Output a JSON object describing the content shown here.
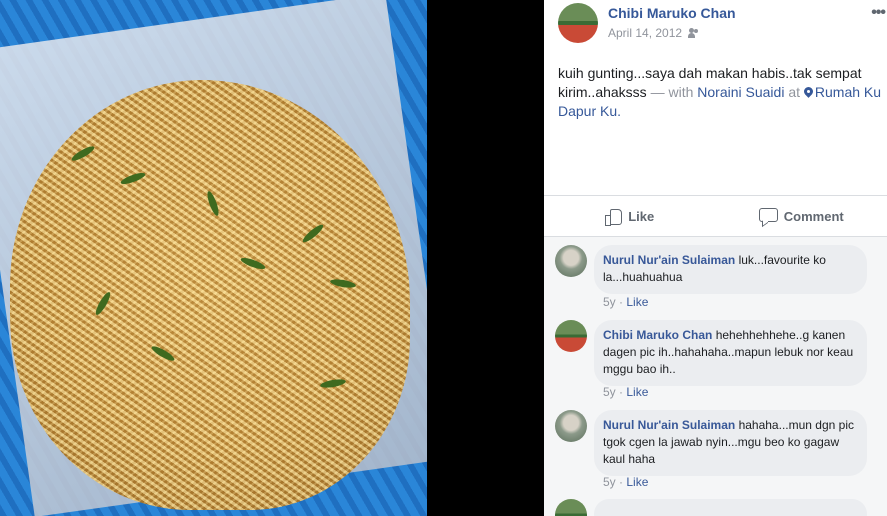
{
  "post": {
    "author": "Chibi Maruko Chan",
    "date": "April 14, 2012",
    "audience_icon": "friends-icon",
    "more_label": "•••",
    "text": "kuih gunting...saya dah makan habis..tak sempat kirim..ahaksss",
    "with_prefix": " — with ",
    "tagged": "Noraini Suaidi",
    "at": " at ",
    "place": "Rumah Ku Dapur Ku."
  },
  "actions": {
    "like": "Like",
    "comment": "Comment"
  },
  "comments": [
    {
      "author": "Nurul Nur'ain Sulaiman",
      "text": "luk...favourite ko la...huahuahua",
      "age": "5y",
      "sep": " · ",
      "like": "Like"
    },
    {
      "author": "Chibi Maruko Chan",
      "text": "hehehhehhehe..g kanen dagen pic ih..hahahaha..mapun lebuk nor keau mggu bao ih..",
      "age": "5y",
      "sep": " · ",
      "like": "Like"
    },
    {
      "author": "Nurul Nur'ain Sulaiman",
      "text": "hahaha...mun dgn pic tgok cgen la jawab nyin...mgu beo ko gagaw kaul haha",
      "age": "5y",
      "sep": " · ",
      "like": "Like"
    }
  ],
  "colors": {
    "link": "#365899",
    "meta": "#90949c",
    "bubble": "#ebedf0"
  }
}
